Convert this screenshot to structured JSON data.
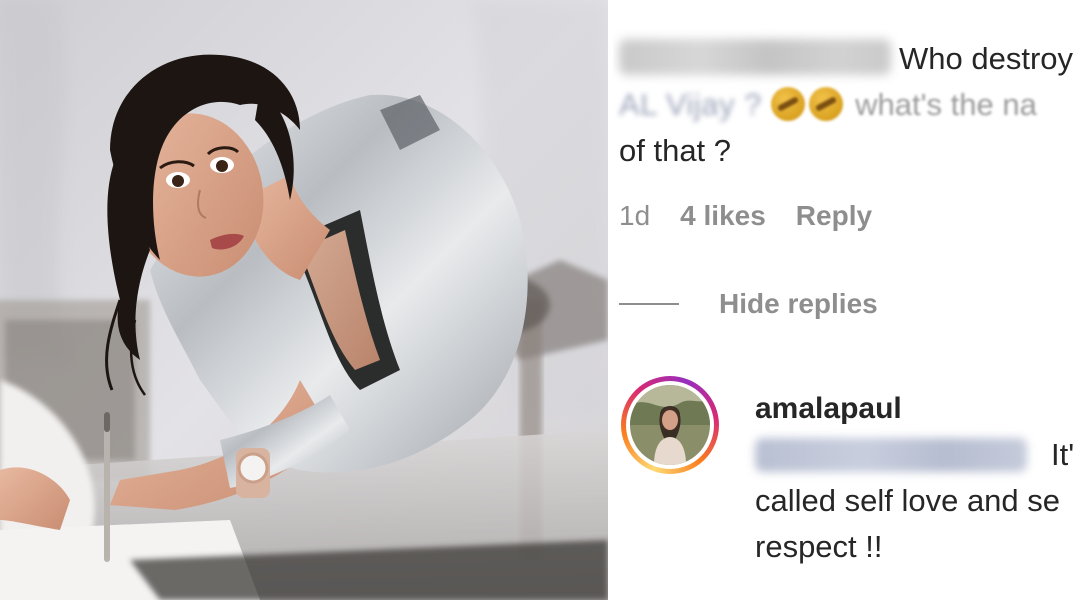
{
  "comment": {
    "text_visible": "Who destroy",
    "mention": "AL Vijay ?",
    "after_emoji": "what's the na",
    "line3": "of that ?",
    "emoji_icons": [
      "grimacing-face-icon",
      "grimacing-face-icon"
    ]
  },
  "comment_meta": {
    "age": "1d",
    "likes": "4 likes",
    "reply_label": "Reply"
  },
  "thread": {
    "hide_replies_label": "Hide replies"
  },
  "reply": {
    "username": "amalapaul",
    "line1_end": "It'",
    "line2": "called self love and se",
    "line3": "respect !!"
  },
  "colors": {
    "text_primary": "#262626",
    "text_secondary": "#8e8e8e",
    "mention_blue": "#9aa2b8",
    "story_ring_start": "#feda75",
    "story_ring_end": "#962fbf"
  }
}
